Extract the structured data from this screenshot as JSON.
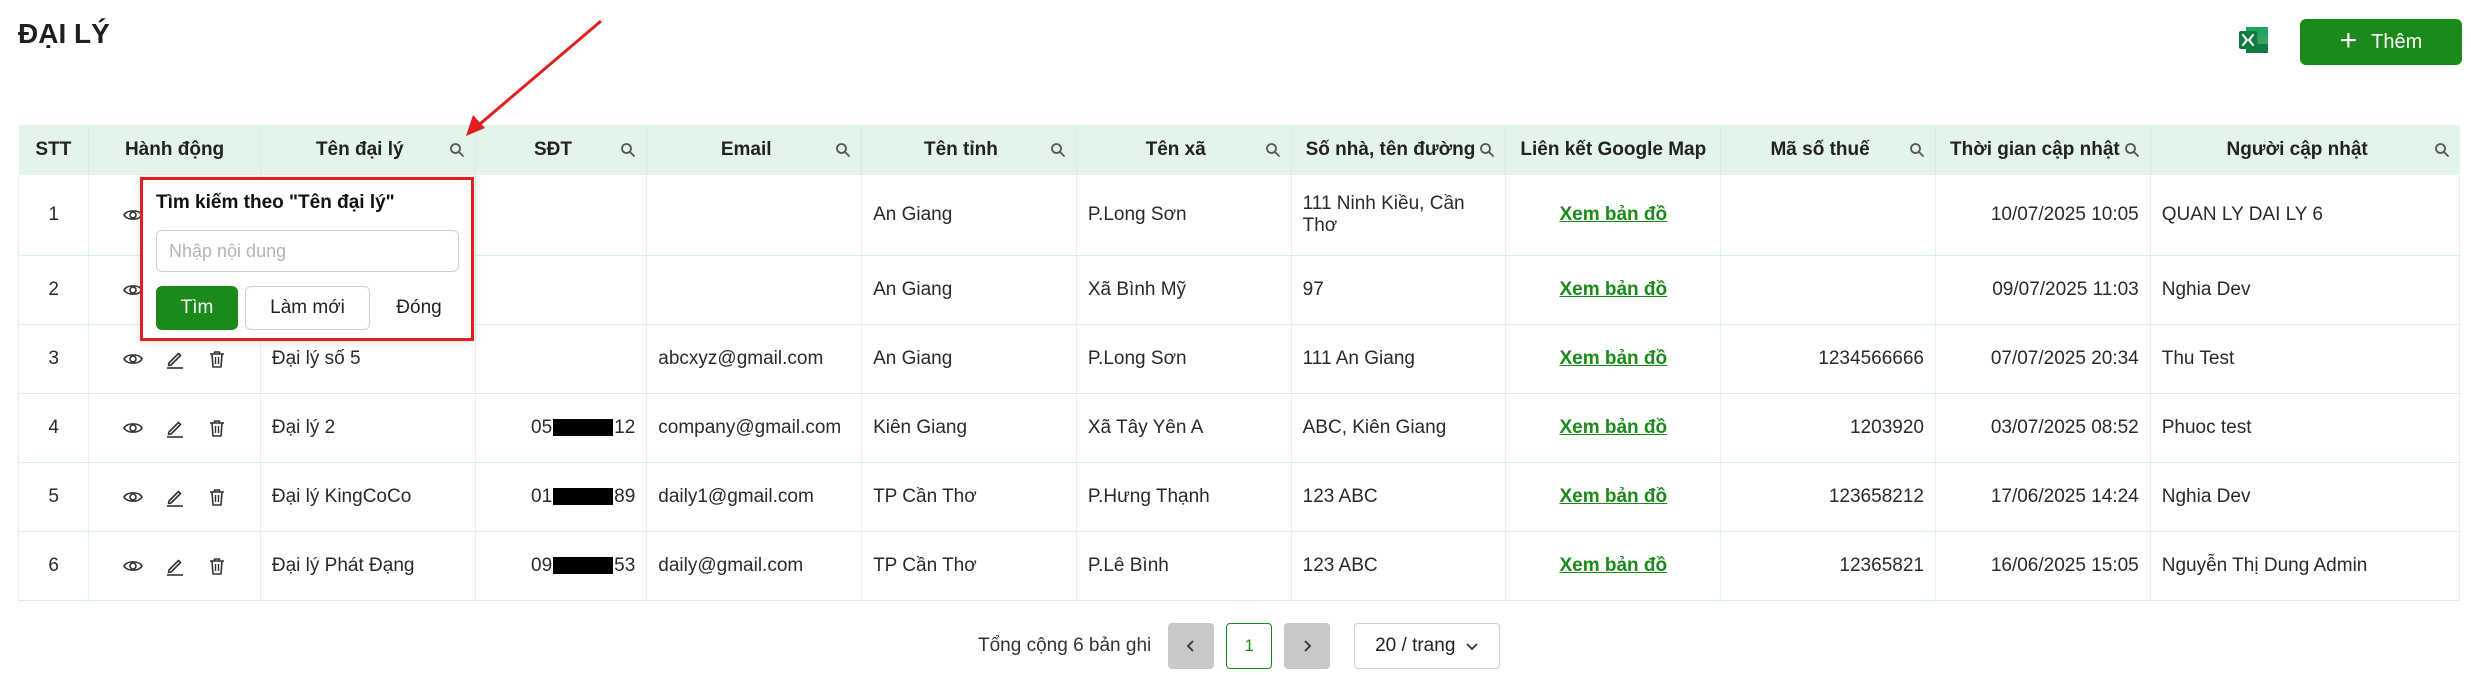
{
  "page": {
    "title": "ĐẠI LÝ",
    "add_label": "Thêm",
    "icons": {
      "excel": "excel-export-icon",
      "add": "plus-icon",
      "search": "search-icon",
      "view": "eye-icon",
      "edit": "edit-icon",
      "delete": "trash-icon"
    },
    "accent_color": "#1b8a1b"
  },
  "table": {
    "columns": [
      "STT",
      "Hành động",
      "Tên đại lý",
      "SĐT",
      "Email",
      "Tên tỉnh",
      "Tên xã",
      "Số nhà, tên đường",
      "Liên kết Google Map",
      "Mã số thuế",
      "Thời gian cập nhật",
      "Người cập nhật"
    ],
    "rows": [
      {
        "stt": "1",
        "name": "",
        "phone_pre": "",
        "phone_post": "",
        "email": "",
        "province": "An Giang",
        "commune": "P.Long Sơn",
        "address": "111 Ninh Kiều, Cần Thơ",
        "map": "Xem bản đồ",
        "tax": "",
        "updated": "10/07/2025 10:05",
        "updater": "QUAN LY DAI LY 6"
      },
      {
        "stt": "2",
        "name": "",
        "phone_pre": "",
        "phone_post": "",
        "email": "",
        "province": "An Giang",
        "commune": "Xã Bình Mỹ",
        "address": "97",
        "map": "Xem bản đồ",
        "tax": "",
        "updated": "09/07/2025 11:03",
        "updater": "Nghia Dev"
      },
      {
        "stt": "3",
        "name": "Đại lý số 5",
        "phone_pre": "",
        "phone_post": "",
        "email": "abcxyz@gmail.com",
        "province": "An Giang",
        "commune": "P.Long Sơn",
        "address": "111 An Giang",
        "map": "Xem bản đồ",
        "tax": "1234566666",
        "updated": "07/07/2025 20:34",
        "updater": "Thu Test"
      },
      {
        "stt": "4",
        "name": "Đại lý 2",
        "phone_pre": "05",
        "phone_post": "12",
        "email": "company@gmail.com",
        "province": "Kiên Giang",
        "commune": "Xã Tây Yên A",
        "address": "ABC, Kiên Giang",
        "map": "Xem bản đồ",
        "tax": "1203920",
        "updated": "03/07/2025 08:52",
        "updater": "Phuoc test"
      },
      {
        "stt": "5",
        "name": "Đại lý KingCoCo",
        "phone_pre": "01",
        "phone_post": "89",
        "email": "daily1@gmail.com",
        "province": "TP Cần Thơ",
        "commune": "P.Hưng Thạnh",
        "address": "123 ABC",
        "map": "Xem bản đồ",
        "tax": "123658212",
        "updated": "17/06/2025 14:24",
        "updater": "Nghia Dev"
      },
      {
        "stt": "6",
        "name": "Đại lý Phát Đạng",
        "phone_pre": "09",
        "phone_post": "53",
        "email": "daily@gmail.com",
        "province": "TP Cần Thơ",
        "commune": "P.Lê Bình",
        "address": "123 ABC",
        "map": "Xem bản đồ",
        "tax": "12365821",
        "updated": "16/06/2025 15:05",
        "updater": "Nguyễn Thị Dung Admin"
      }
    ]
  },
  "popup": {
    "title": "Tìm kiếm theo \"Tên đại lý\"",
    "input_value": "",
    "input_placeholder": "Nhập nội dung",
    "search_label": "Tìm",
    "reset_label": "Làm mới",
    "close_label": "Đóng",
    "border_color": "#e02020"
  },
  "pagination": {
    "total_text": "Tổng cộng 6 bản ghi",
    "current_page": "1",
    "page_size": "20 / trang"
  }
}
